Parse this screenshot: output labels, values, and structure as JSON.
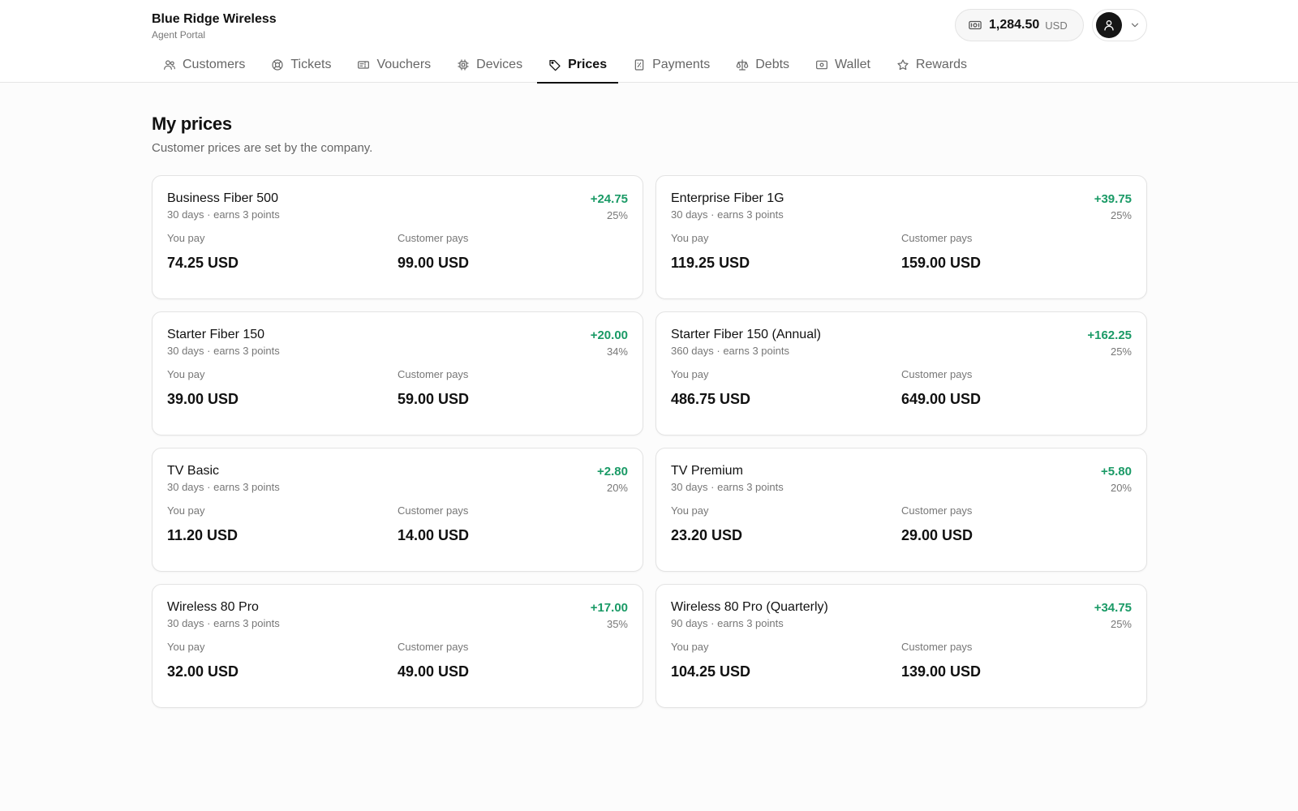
{
  "brand": {
    "name": "Blue Ridge Wireless",
    "subtitle": "Agent Portal"
  },
  "balance": {
    "amount": "1,284.50",
    "currency": "USD",
    "icon": "cash-icon"
  },
  "user_menu": {
    "avatar_icon": "user-icon",
    "chevron_icon": "chevron-down-icon"
  },
  "nav": {
    "tabs": [
      {
        "label": "Customers",
        "icon": "users-icon",
        "active": false
      },
      {
        "label": "Tickets",
        "icon": "lifebuoy-icon",
        "active": false
      },
      {
        "label": "Vouchers",
        "icon": "ticket-icon",
        "active": false
      },
      {
        "label": "Devices",
        "icon": "chip-icon",
        "active": false
      },
      {
        "label": "Prices",
        "icon": "tag-icon",
        "active": true
      },
      {
        "label": "Payments",
        "icon": "receipt-icon",
        "active": false
      },
      {
        "label": "Debts",
        "icon": "scale-icon",
        "active": false
      },
      {
        "label": "Wallet",
        "icon": "wallet-icon",
        "active": false
      },
      {
        "label": "Rewards",
        "icon": "star-icon",
        "active": false
      }
    ]
  },
  "page": {
    "title": "My prices",
    "subtitle": "Customer prices are set by the company.",
    "you_pay_label": "You pay",
    "customer_pays_label": "Customer pays"
  },
  "colors": {
    "profit": "#1a9a66",
    "accent": "#111111"
  },
  "plans": [
    {
      "name": "Business Fiber 500",
      "meta": "30 days · earns 3 points",
      "profit": "+24.75",
      "percent": "25%",
      "you_pay": "74.25 USD",
      "customer_pays": "99.00 USD"
    },
    {
      "name": "Enterprise Fiber 1G",
      "meta": "30 days · earns 3 points",
      "profit": "+39.75",
      "percent": "25%",
      "you_pay": "119.25 USD",
      "customer_pays": "159.00 USD"
    },
    {
      "name": "Starter Fiber 150",
      "meta": "30 days · earns 3 points",
      "profit": "+20.00",
      "percent": "34%",
      "you_pay": "39.00 USD",
      "customer_pays": "59.00 USD"
    },
    {
      "name": "Starter Fiber 150 (Annual)",
      "meta": "360 days · earns 3 points",
      "profit": "+162.25",
      "percent": "25%",
      "you_pay": "486.75 USD",
      "customer_pays": "649.00 USD"
    },
    {
      "name": "TV Basic",
      "meta": "30 days · earns 3 points",
      "profit": "+2.80",
      "percent": "20%",
      "you_pay": "11.20 USD",
      "customer_pays": "14.00 USD"
    },
    {
      "name": "TV Premium",
      "meta": "30 days · earns 3 points",
      "profit": "+5.80",
      "percent": "20%",
      "you_pay": "23.20 USD",
      "customer_pays": "29.00 USD"
    },
    {
      "name": "Wireless 80 Pro",
      "meta": "30 days · earns 3 points",
      "profit": "+17.00",
      "percent": "35%",
      "you_pay": "32.00 USD",
      "customer_pays": "49.00 USD"
    },
    {
      "name": "Wireless 80 Pro (Quarterly)",
      "meta": "90 days · earns 3 points",
      "profit": "+34.75",
      "percent": "25%",
      "you_pay": "104.25 USD",
      "customer_pays": "139.00 USD"
    }
  ]
}
